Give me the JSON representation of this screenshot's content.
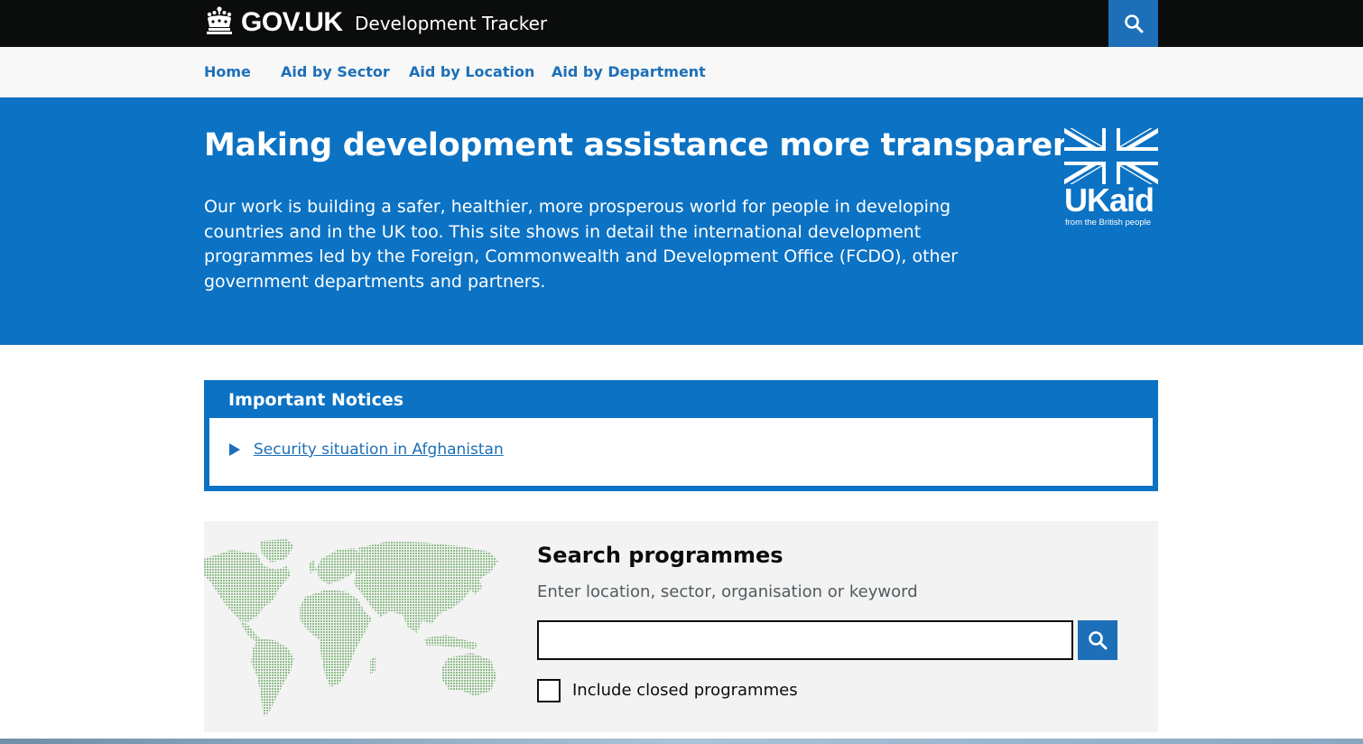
{
  "header": {
    "logo_text": "GOV.UK",
    "service_name": "Development Tracker",
    "search_icon": "search-icon"
  },
  "nav": {
    "items": [
      {
        "label": "Home"
      },
      {
        "label": "Aid by Sector"
      },
      {
        "label": "Aid by Location"
      },
      {
        "label": "Aid by Department"
      }
    ]
  },
  "hero": {
    "title": "Making development assistance more transparent",
    "text": "Our work is building a safer, healthier, more prosperous world for people in developing countries and in the UK too. This site shows in detail the international development programmes led by the Foreign, Commonwealth and Development Office (FCDO), other government departments and partners.",
    "logo_text": "UKaid",
    "logo_tagline": "from the British people"
  },
  "notices": {
    "title": "Important Notices",
    "items": [
      {
        "label": "Security situation in Afghanistan"
      }
    ]
  },
  "search": {
    "title": "Search programmes",
    "hint": "Enter location, sector, organisation or keyword",
    "input_value": "",
    "checkbox_label": "Include closed programmes",
    "checkbox_checked": false
  },
  "colors": {
    "header_bg": "#0b0c0c",
    "brand_blue": "#1d70b8",
    "hero_blue": "#0b72c4",
    "panel_bg": "#f3f3f3",
    "map_green": "#8fbf8a"
  }
}
